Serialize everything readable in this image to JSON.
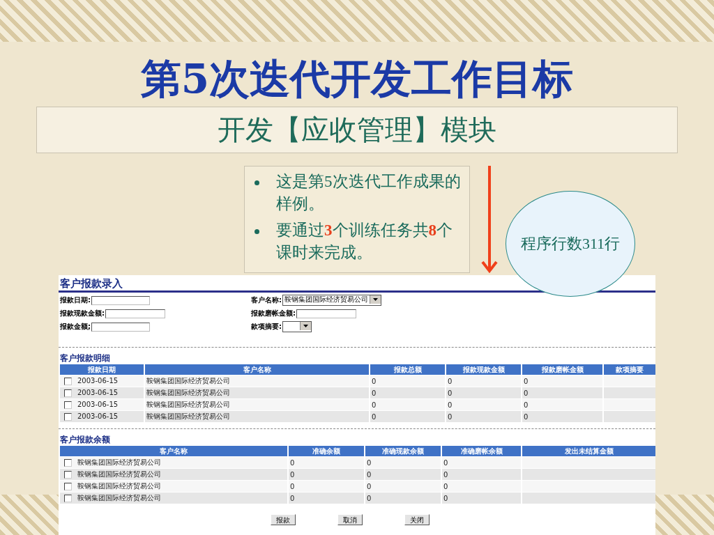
{
  "slide": {
    "title": "第5次迭代开发工作目标",
    "subtitle": "开发【应收管理】模块",
    "bullets": [
      "这是第5次迭代工作成果的样例。",
      "要通过**3**个训练任务共**8**个课时来完成。"
    ],
    "callout": "程序行数311行"
  },
  "form": {
    "title": "客户报款录入",
    "fields": [
      {
        "label": "报款日期:",
        "kind": "text"
      },
      {
        "label": "客户名称:",
        "kind": "select",
        "value": "鞍钢集团国际经济贸易公司"
      },
      {
        "label": "报款现款金额:",
        "kind": "text"
      },
      {
        "label": "报款磨帐金额:",
        "kind": "text"
      },
      {
        "label": "报款金额;",
        "kind": "text"
      },
      {
        "label": "款项摘要:",
        "kind": "select"
      }
    ]
  },
  "detail": {
    "title": "客户报款明细",
    "columns": [
      "报款日期",
      "客户名称",
      "报款总额",
      "报款现款金额",
      "报款磨帐金额",
      "款项摘要"
    ],
    "rows": [
      {
        "checked": false,
        "cells": [
          "2003-06-15",
          "鞍钢集团国际经济贸易公司",
          "0",
          "0",
          "0"
        ]
      },
      {
        "checked": false,
        "cells": [
          "2003-06-15",
          "鞍钢集团国际经济贸易公司",
          "0",
          "0",
          "0"
        ]
      },
      {
        "checked": false,
        "cells": [
          "2003-06-15",
          "鞍钢集团国际经济贸易公司",
          "0",
          "0",
          "0"
        ]
      },
      {
        "checked": false,
        "cells": [
          "2003-06-15",
          "鞍钢集团国际经济贸易公司",
          "0",
          "0",
          "0"
        ]
      }
    ]
  },
  "balance": {
    "title": "客户报款余额",
    "columns": [
      "客户名称",
      "准确余额",
      "准确现款余额",
      "准确磨帐余额",
      "发出未结算金额"
    ],
    "rows": [
      {
        "checked": false,
        "cells": [
          "鞍钢集团国际经济贸易公司",
          "0",
          "0",
          "0"
        ]
      },
      {
        "checked": false,
        "cells": [
          "鞍钢集团国际经济贸易公司",
          "0",
          "0",
          "0"
        ]
      },
      {
        "checked": false,
        "cells": [
          "鞍钢集团国际经济贸易公司",
          "0",
          "0",
          "0"
        ]
      },
      {
        "checked": false,
        "cells": [
          "鞍钢集团国际经济贸易公司",
          "0",
          "0",
          "0"
        ]
      }
    ]
  },
  "buttons": [
    "报款",
    "取消",
    "关闭"
  ]
}
